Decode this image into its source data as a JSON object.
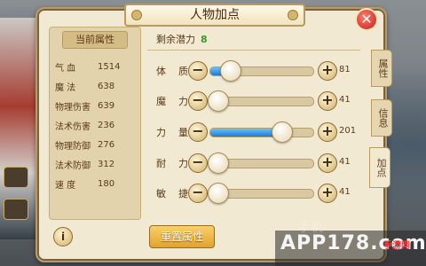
{
  "title": "人物加点",
  "left_panel": {
    "header": "当前属性",
    "attributes": [
      {
        "name": "气  血",
        "value": "1514"
      },
      {
        "name": "魔  法",
        "value": "638"
      },
      {
        "name": "物理伤害",
        "value": "639"
      },
      {
        "name": "法术伤害",
        "value": "236"
      },
      {
        "name": "物理防御",
        "value": "276"
      },
      {
        "name": "法术防御",
        "value": "312"
      },
      {
        "name": "速  度",
        "value": "180"
      }
    ]
  },
  "remaining": {
    "label": "剩余潜力",
    "value": "8"
  },
  "stats": [
    {
      "label": "体质",
      "value": "81",
      "fill": 0.12
    },
    {
      "label": "魔力",
      "value": "41",
      "fill": 0.0
    },
    {
      "label": "力量",
      "value": "201",
      "fill": 0.62
    },
    {
      "label": "耐力",
      "value": "41",
      "fill": 0.0
    },
    {
      "label": "敏捷",
      "value": "41",
      "fill": 0.0
    }
  ],
  "reset_button": "重置属性",
  "side_tabs": [
    "属性",
    "信息",
    "加点"
  ],
  "watermark": {
    "main": "APP178.com",
    "sub": "手游网",
    "faded": "手机"
  }
}
